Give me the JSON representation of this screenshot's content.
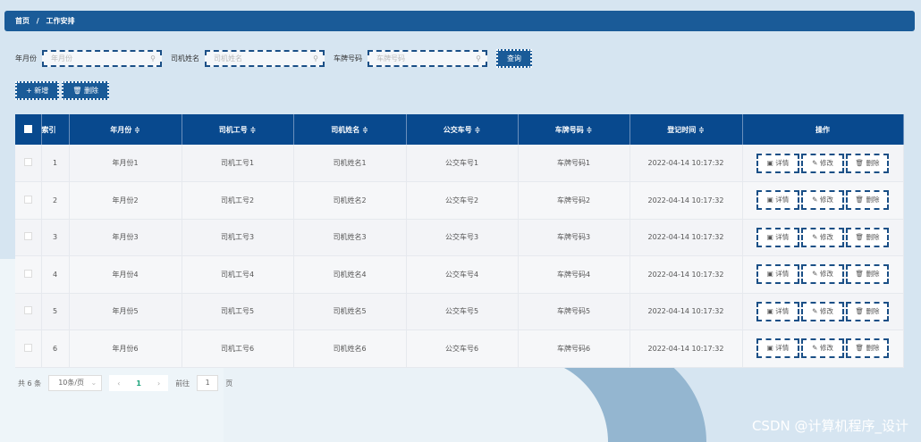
{
  "breadcrumb": {
    "home": "首页",
    "sep": "/",
    "current": "工作安排"
  },
  "search": {
    "fields": [
      {
        "label": "年月份",
        "placeholder": "年月份"
      },
      {
        "label": "司机姓名",
        "placeholder": "司机姓名"
      },
      {
        "label": "车牌号码",
        "placeholder": "车牌号码"
      }
    ],
    "query": "查询"
  },
  "toolbar": {
    "add": "+ 新增",
    "delete": "🗑 删除"
  },
  "table": {
    "headers": [
      "索引",
      "年月份 ≑",
      "司机工号 ≑",
      "司机姓名 ≑",
      "公交车号 ≑",
      "车牌号码 ≑",
      "登记时间 ≑",
      "操作"
    ],
    "rows": [
      [
        "1",
        "年月份1",
        "司机工号1",
        "司机姓名1",
        "公交车号1",
        "车牌号码1",
        "2022-04-14 10:17:32"
      ],
      [
        "2",
        "年月份2",
        "司机工号2",
        "司机姓名2",
        "公交车号2",
        "车牌号码2",
        "2022-04-14 10:17:32"
      ],
      [
        "3",
        "年月份3",
        "司机工号3",
        "司机姓名3",
        "公交车号3",
        "车牌号码3",
        "2022-04-14 10:17:32"
      ],
      [
        "4",
        "年月份4",
        "司机工号4",
        "司机姓名4",
        "公交车号4",
        "车牌号码4",
        "2022-04-14 10:17:32"
      ],
      [
        "5",
        "年月份5",
        "司机工号5",
        "司机姓名5",
        "公交车号5",
        "车牌号码5",
        "2022-04-14 10:17:32"
      ],
      [
        "6",
        "年月份6",
        "司机工号6",
        "司机姓名6",
        "公交车号6",
        "车牌号码6",
        "2022-04-14 10:17:32"
      ]
    ],
    "actions": [
      "▣ 详情",
      "✎ 修改",
      "🗑 删除"
    ]
  },
  "pagination": {
    "total": "共 6 条",
    "page_size": "10条/页",
    "prev": "‹",
    "current": "1",
    "next": "›",
    "goto": "前往",
    "goto_value": "1",
    "page_unit": "页"
  },
  "watermark": "CSDN @计算机程序_设计"
}
